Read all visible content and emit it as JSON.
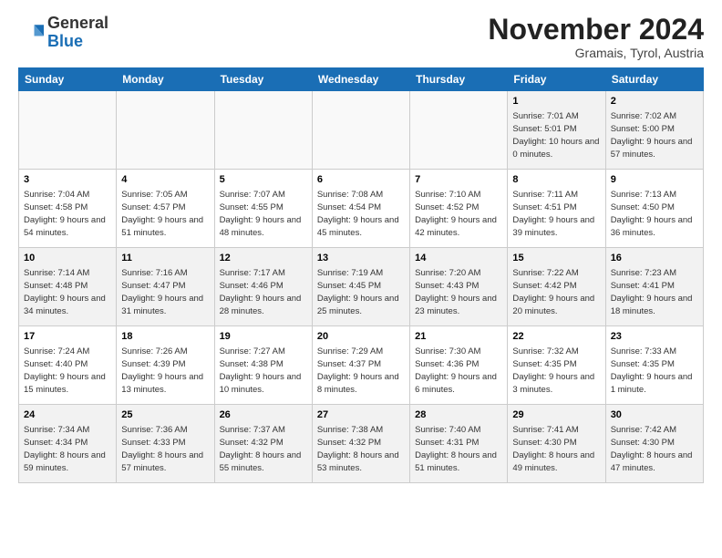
{
  "header": {
    "logo_general": "General",
    "logo_blue": "Blue",
    "month_title": "November 2024",
    "subtitle": "Gramais, Tyrol, Austria"
  },
  "weekdays": [
    "Sunday",
    "Monday",
    "Tuesday",
    "Wednesday",
    "Thursday",
    "Friday",
    "Saturday"
  ],
  "weeks": [
    [
      {
        "day": "",
        "info": ""
      },
      {
        "day": "",
        "info": ""
      },
      {
        "day": "",
        "info": ""
      },
      {
        "day": "",
        "info": ""
      },
      {
        "day": "",
        "info": ""
      },
      {
        "day": "1",
        "info": "Sunrise: 7:01 AM\nSunset: 5:01 PM\nDaylight: 10 hours and 0 minutes."
      },
      {
        "day": "2",
        "info": "Sunrise: 7:02 AM\nSunset: 5:00 PM\nDaylight: 9 hours and 57 minutes."
      }
    ],
    [
      {
        "day": "3",
        "info": "Sunrise: 7:04 AM\nSunset: 4:58 PM\nDaylight: 9 hours and 54 minutes."
      },
      {
        "day": "4",
        "info": "Sunrise: 7:05 AM\nSunset: 4:57 PM\nDaylight: 9 hours and 51 minutes."
      },
      {
        "day": "5",
        "info": "Sunrise: 7:07 AM\nSunset: 4:55 PM\nDaylight: 9 hours and 48 minutes."
      },
      {
        "day": "6",
        "info": "Sunrise: 7:08 AM\nSunset: 4:54 PM\nDaylight: 9 hours and 45 minutes."
      },
      {
        "day": "7",
        "info": "Sunrise: 7:10 AM\nSunset: 4:52 PM\nDaylight: 9 hours and 42 minutes."
      },
      {
        "day": "8",
        "info": "Sunrise: 7:11 AM\nSunset: 4:51 PM\nDaylight: 9 hours and 39 minutes."
      },
      {
        "day": "9",
        "info": "Sunrise: 7:13 AM\nSunset: 4:50 PM\nDaylight: 9 hours and 36 minutes."
      }
    ],
    [
      {
        "day": "10",
        "info": "Sunrise: 7:14 AM\nSunset: 4:48 PM\nDaylight: 9 hours and 34 minutes."
      },
      {
        "day": "11",
        "info": "Sunrise: 7:16 AM\nSunset: 4:47 PM\nDaylight: 9 hours and 31 minutes."
      },
      {
        "day": "12",
        "info": "Sunrise: 7:17 AM\nSunset: 4:46 PM\nDaylight: 9 hours and 28 minutes."
      },
      {
        "day": "13",
        "info": "Sunrise: 7:19 AM\nSunset: 4:45 PM\nDaylight: 9 hours and 25 minutes."
      },
      {
        "day": "14",
        "info": "Sunrise: 7:20 AM\nSunset: 4:43 PM\nDaylight: 9 hours and 23 minutes."
      },
      {
        "day": "15",
        "info": "Sunrise: 7:22 AM\nSunset: 4:42 PM\nDaylight: 9 hours and 20 minutes."
      },
      {
        "day": "16",
        "info": "Sunrise: 7:23 AM\nSunset: 4:41 PM\nDaylight: 9 hours and 18 minutes."
      }
    ],
    [
      {
        "day": "17",
        "info": "Sunrise: 7:24 AM\nSunset: 4:40 PM\nDaylight: 9 hours and 15 minutes."
      },
      {
        "day": "18",
        "info": "Sunrise: 7:26 AM\nSunset: 4:39 PM\nDaylight: 9 hours and 13 minutes."
      },
      {
        "day": "19",
        "info": "Sunrise: 7:27 AM\nSunset: 4:38 PM\nDaylight: 9 hours and 10 minutes."
      },
      {
        "day": "20",
        "info": "Sunrise: 7:29 AM\nSunset: 4:37 PM\nDaylight: 9 hours and 8 minutes."
      },
      {
        "day": "21",
        "info": "Sunrise: 7:30 AM\nSunset: 4:36 PM\nDaylight: 9 hours and 6 minutes."
      },
      {
        "day": "22",
        "info": "Sunrise: 7:32 AM\nSunset: 4:35 PM\nDaylight: 9 hours and 3 minutes."
      },
      {
        "day": "23",
        "info": "Sunrise: 7:33 AM\nSunset: 4:35 PM\nDaylight: 9 hours and 1 minute."
      }
    ],
    [
      {
        "day": "24",
        "info": "Sunrise: 7:34 AM\nSunset: 4:34 PM\nDaylight: 8 hours and 59 minutes."
      },
      {
        "day": "25",
        "info": "Sunrise: 7:36 AM\nSunset: 4:33 PM\nDaylight: 8 hours and 57 minutes."
      },
      {
        "day": "26",
        "info": "Sunrise: 7:37 AM\nSunset: 4:32 PM\nDaylight: 8 hours and 55 minutes."
      },
      {
        "day": "27",
        "info": "Sunrise: 7:38 AM\nSunset: 4:32 PM\nDaylight: 8 hours and 53 minutes."
      },
      {
        "day": "28",
        "info": "Sunrise: 7:40 AM\nSunset: 4:31 PM\nDaylight: 8 hours and 51 minutes."
      },
      {
        "day": "29",
        "info": "Sunrise: 7:41 AM\nSunset: 4:30 PM\nDaylight: 8 hours and 49 minutes."
      },
      {
        "day": "30",
        "info": "Sunrise: 7:42 AM\nSunset: 4:30 PM\nDaylight: 8 hours and 47 minutes."
      }
    ]
  ]
}
